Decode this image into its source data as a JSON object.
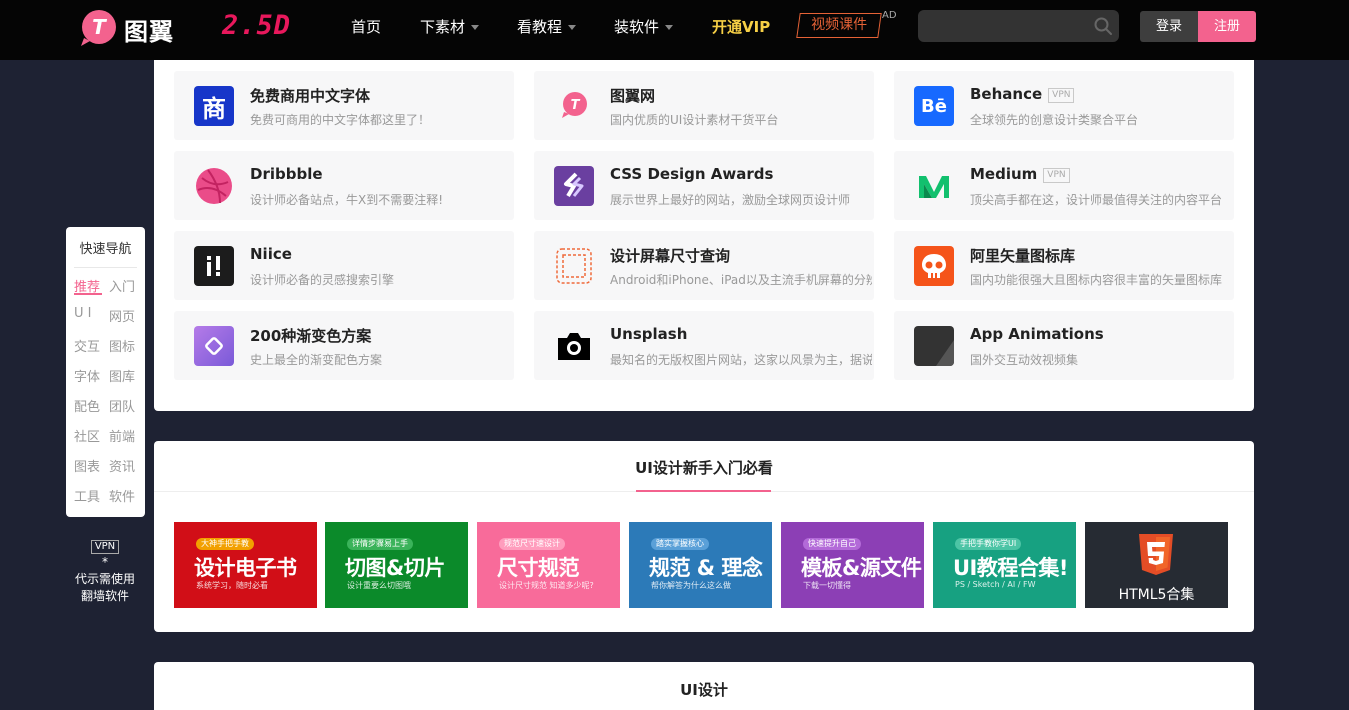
{
  "header": {
    "logo_text": "图翼",
    "version": "2.5D",
    "nav": [
      {
        "label": "首页",
        "dropdown": false
      },
      {
        "label": "下素材",
        "dropdown": true
      },
      {
        "label": "看教程",
        "dropdown": true
      },
      {
        "label": "装软件",
        "dropdown": true
      },
      {
        "label": "开通VIP",
        "dropdown": false
      }
    ],
    "course_label": "视频课件",
    "ad_label": "AD",
    "search": {
      "value": "",
      "placeholder": ""
    },
    "login_label": "登录",
    "register_label": "注册"
  },
  "sites": [
    {
      "name": "免费商用中文字体",
      "desc": "免费可商用的中文字体都这里了！",
      "vpn": "",
      "icon": "shang-icon",
      "glyph": "商",
      "color": "#1736c9"
    },
    {
      "name": "图翼网",
      "desc": "国内优质的UI设计素材干货平台",
      "vpn": "",
      "icon": "tuyi-icon",
      "glyph": "T",
      "color": "#f3628e"
    },
    {
      "name": "Behance",
      "desc": "全球领先的创意设计类聚合平台",
      "vpn": "VPN",
      "icon": "behance-icon",
      "glyph": "Bē",
      "color": "#1769ff"
    },
    {
      "name": "Dribbble",
      "desc": "设计师必备站点，牛X到不需要注释!",
      "vpn": "",
      "icon": "dribbble-icon",
      "glyph": "",
      "color": "#ea4c89"
    },
    {
      "name": "CSS Design Awards",
      "desc": "展示世界上最好的网站，激励全球网页设计师",
      "vpn": "",
      "icon": "cssda-icon",
      "glyph": "",
      "color": "#6a3fa0"
    },
    {
      "name": "Medium",
      "desc": "顶尖高手都在这，设计师最值得关注的内容平台",
      "vpn": "VPN",
      "icon": "medium-icon",
      "glyph": "",
      "color": "#12c06e"
    },
    {
      "name": "Niice",
      "desc": "设计师必备的灵感搜索引擎",
      "vpn": "",
      "icon": "niice-icon",
      "glyph": "i!",
      "color": "#1c1c1c"
    },
    {
      "name": "设计屏幕尺寸查询",
      "desc": "Android和iPhone、iPad以及主流手机屏幕的分辨率",
      "vpn": "",
      "icon": "screen-size-icon",
      "glyph": "",
      "color": "#ef6a3a"
    },
    {
      "name": "阿里矢量图标库",
      "desc": "国内功能很强大且图标内容很丰富的矢量图标库",
      "vpn": "",
      "icon": "iconfont-icon",
      "glyph": "",
      "color": "#f5541a"
    },
    {
      "name": "200种渐变色方案",
      "desc": "史上最全的渐变配色方案",
      "vpn": "",
      "icon": "gradient-icon",
      "glyph": "",
      "color": "#9a6ee0"
    },
    {
      "name": "Unsplash",
      "desc": "最知名的无版权图片网站，这家以风景为主，据说",
      "vpn": "",
      "icon": "camera-icon",
      "glyph": "",
      "color": "#000000"
    },
    {
      "name": "App Animations",
      "desc": "国外交互动效视频集",
      "vpn": "",
      "icon": "app-animations-icon",
      "glyph": "",
      "color": "#333333"
    }
  ],
  "intro": {
    "title": "UI设计新手入门必看",
    "banners": [
      {
        "tag": "大神手把手教",
        "main": "设计电子书",
        "sub": "系统学习，随时必看",
        "bg": "#d10e17",
        "tagbg": "#f2a000"
      },
      {
        "tag": "详情步骤易上手",
        "main": "切图&切片",
        "sub": "设计重要么切图哦",
        "bg": "#0b8a2a",
        "tagbg": "#3ab35a"
      },
      {
        "tag": "规范尺寸速设计",
        "main": "尺寸规范",
        "sub": "设计尺寸规范 知道多少呢?",
        "bg": "#f86b9a",
        "tagbg": "#ff9dbd"
      },
      {
        "tag": "踏实掌握核心",
        "main": "规范 & 理念",
        "sub": "帮你解答为什么这么做",
        "bg": "#2c7ab8",
        "tagbg": "#5aa0d8"
      },
      {
        "tag": "快速提升自己",
        "main": "模板&源文件",
        "sub": "下载一切懂得",
        "bg": "#8c3fb5",
        "tagbg": "#b36ad8"
      },
      {
        "tag": "手把手教你学UI",
        "main": "UI教程合集!",
        "sub": "PS / Sketch / AI / FW",
        "bg": "#17a181",
        "tagbg": "#4cc4a5"
      },
      {
        "tag": "",
        "main": "HTML5合集",
        "sub": "",
        "bg": "#262b33",
        "tagbg": ""
      }
    ]
  },
  "ui_section_title": "UI设计",
  "quick_nav": {
    "title": "快速导航",
    "rows": [
      [
        "推荐",
        "入门"
      ],
      [
        "U I",
        "网页"
      ],
      [
        "交互",
        "图标"
      ],
      [
        "字体",
        "图库"
      ],
      [
        "配色",
        "团队"
      ],
      [
        "社区",
        "前端"
      ],
      [
        "图表",
        "资讯"
      ],
      [
        "工具",
        "软件"
      ]
    ]
  },
  "side_note": {
    "vpn": "VPN",
    "star": "*",
    "line1": "代示需使用",
    "line2": "翻墙软件"
  },
  "colors": {
    "accent": "#f3628e",
    "vip": "#f7d046",
    "course": "#e66236",
    "background": "#1e2233"
  }
}
